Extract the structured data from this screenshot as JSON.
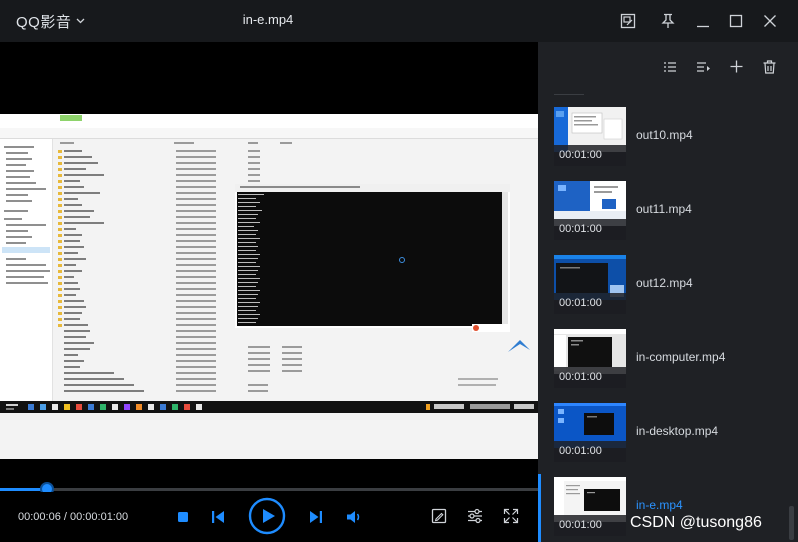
{
  "app": {
    "name": "QQ影音"
  },
  "window": {
    "file_title": "in-e.mp4"
  },
  "titlebar_icons": [
    "pip-icon",
    "pin-icon",
    "minimize-icon",
    "maximize-icon",
    "close-icon"
  ],
  "player": {
    "time_text": "00:00:06 / 00:00:01:00",
    "progress": 0.088,
    "accent": "#1e8cff"
  },
  "playlist": {
    "toolbar_icons": [
      "list-mode-icon",
      "play-order-icon",
      "add-icon",
      "delete-icon"
    ],
    "items": [
      {
        "name": "out10.mp4",
        "duration": "00:01:00",
        "thumb": "desktop-white"
      },
      {
        "name": "out11.mp4",
        "duration": "00:01:00",
        "thumb": "desktop-blue"
      },
      {
        "name": "out12.mp4",
        "duration": "00:01:00",
        "thumb": "desktop-dark"
      },
      {
        "name": "in-computer.mp4",
        "duration": "00:01:00",
        "thumb": "window-dark"
      },
      {
        "name": "in-desktop.mp4",
        "duration": "00:01:00",
        "thumb": "desktop-blue2"
      },
      {
        "name": "in-e.mp4",
        "duration": "00:01:00",
        "thumb": "explorer",
        "active": true
      }
    ]
  },
  "watermark": "CSDN @tusong86"
}
